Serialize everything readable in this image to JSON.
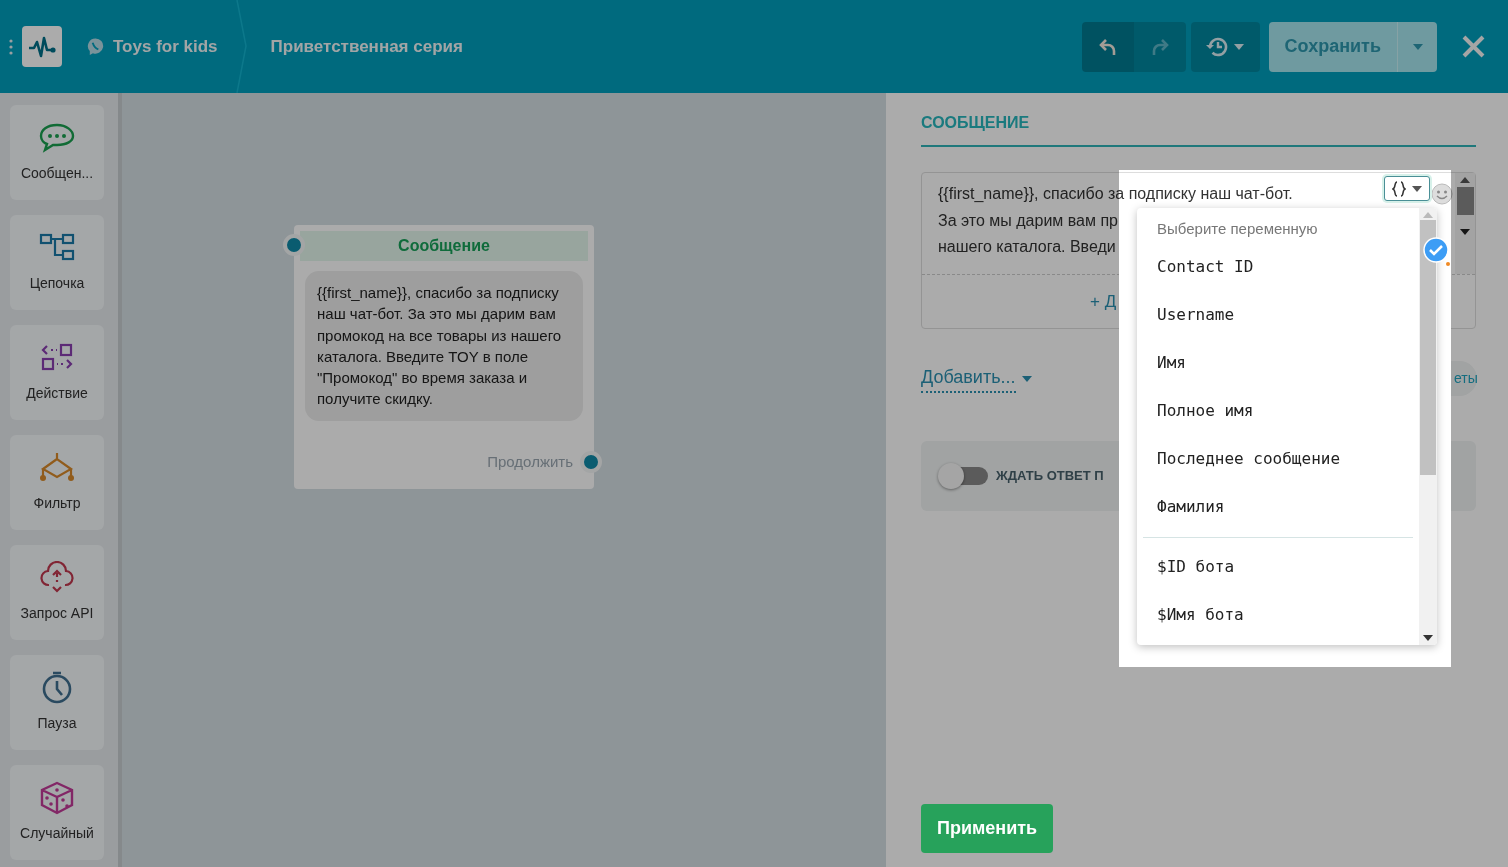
{
  "header": {
    "bot_name": "Toys for kids",
    "flow_name": "Приветственная серия",
    "undo_enabled": true,
    "redo_enabled": false,
    "save_label": "Сохранить"
  },
  "sidebar": {
    "items": [
      {
        "label": "Сообщен...",
        "kind": "message"
      },
      {
        "label": "Цепочка",
        "kind": "chain"
      },
      {
        "label": "Действие",
        "kind": "action"
      },
      {
        "label": "Фильтр",
        "kind": "filter"
      },
      {
        "label": "Запрос API",
        "kind": "api"
      },
      {
        "label": "Пауза",
        "kind": "pause"
      },
      {
        "label": "Случайный",
        "kind": "random"
      }
    ]
  },
  "canvas": {
    "node": {
      "title": "Сообщение",
      "text": "{{first_name}}, спасибо за подписку наш чат-бот. За это мы дарим вам промокод на все товары из нашего каталога. Введите TOY в поле \"Промокод\" во время заказа и получите скидку.",
      "continue_label": "Продолжить"
    }
  },
  "panel": {
    "title": "СООБЩЕНИЕ",
    "message_lines": [
      "{{first_name}}, спасибо за подписку наш чат-бот.",
      "За это мы дарим вам пр",
      "нашего каталога. Введи"
    ],
    "add_partial": "+ Д",
    "add_menu": "Добавить...",
    "pill_partial": "еты",
    "wait_toggle": {
      "label": "ЖДАТЬ ОТВЕТ П",
      "on": false
    },
    "apply_label": "Применить"
  },
  "variable_menu": {
    "header": "Выберите переменную",
    "groups": [
      [
        "Contact ID",
        "Username",
        "Имя",
        "Полное имя",
        "Последнее сообщение",
        "Фамилия"
      ],
      [
        "$ID бота",
        "$Имя бота"
      ]
    ]
  }
}
